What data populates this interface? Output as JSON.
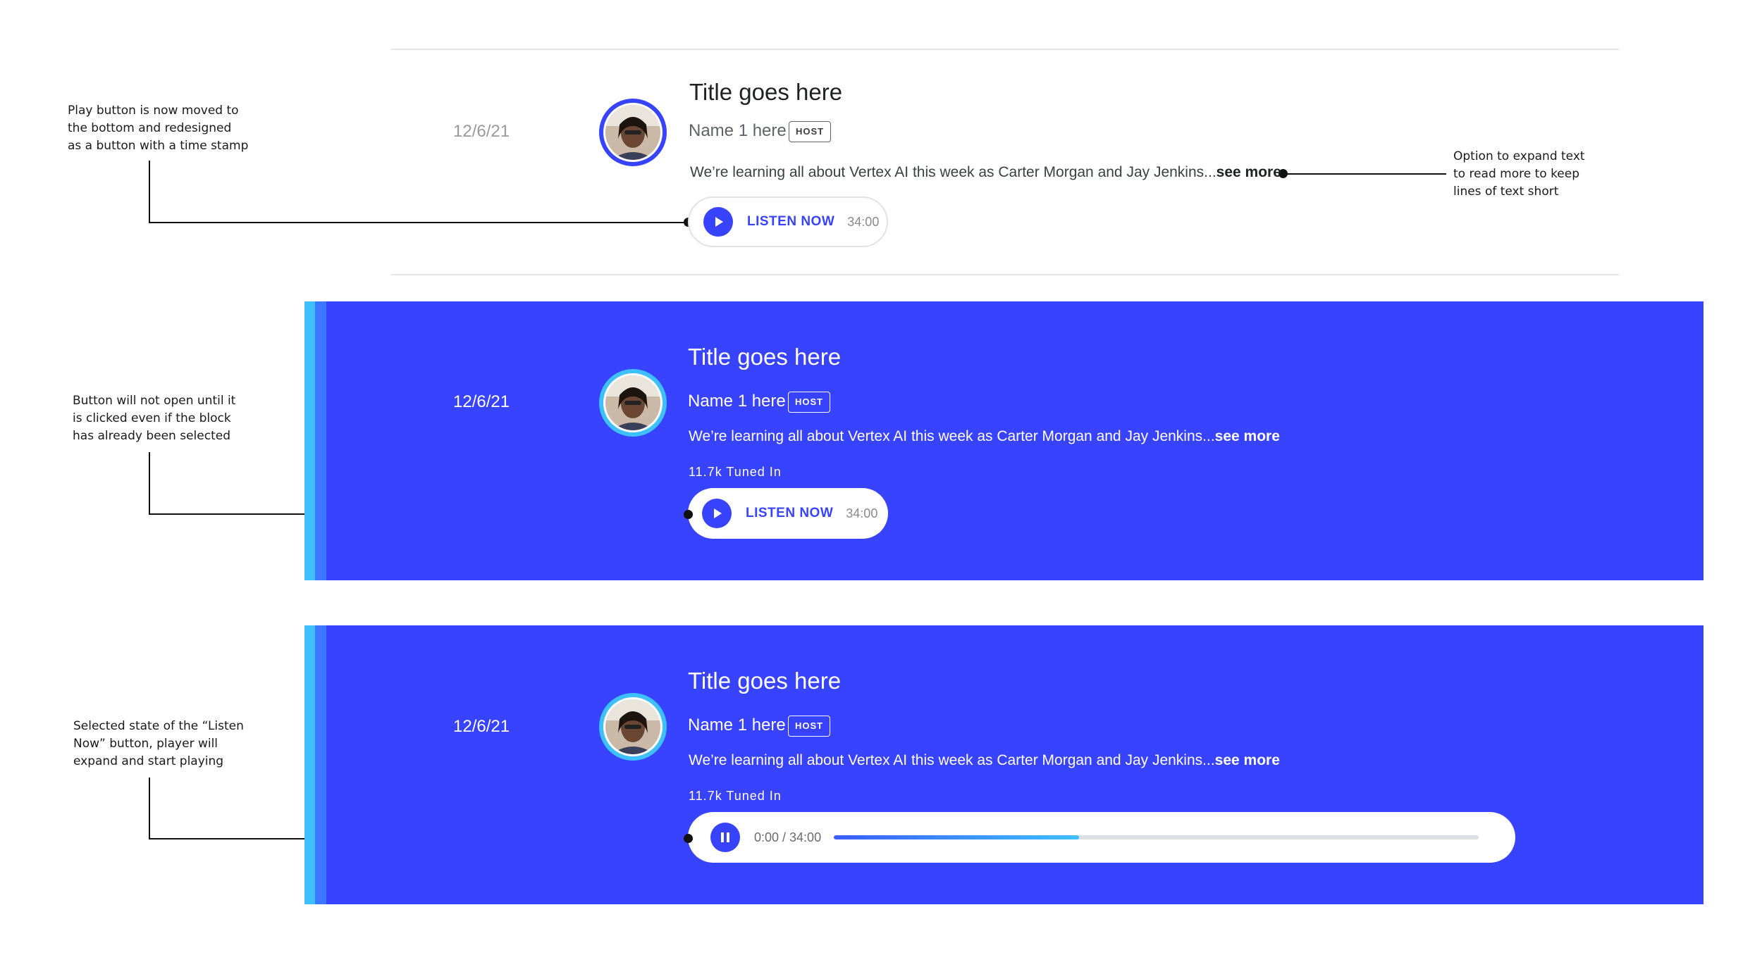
{
  "annotations": [
    {
      "text": "Play button is now moved to\nthe bottom and redesigned\nas a button with a time stamp"
    },
    {
      "text": "Option to expand text\nto read more to keep\nlines of text short"
    },
    {
      "text": "Button will not open until it\nis clicked even if the block\nhas already been selected"
    },
    {
      "text": "Selected state of the “Listen\nNow” button, player will\nexpand and start playing"
    }
  ],
  "colors": {
    "accent": "#3843ff",
    "stripe_light": "#3ec0ff",
    "stripe_mid": "#3a78ff",
    "divider": "#e6e6e6"
  },
  "cards": [
    {
      "state": "default",
      "date": "12/6/21",
      "title": "Title goes here",
      "name": "Name 1 here",
      "badge": "HOST",
      "description": "We’re learning all about Vertex AI this week as Carter Morgan and Jay Jenkins...",
      "see_more": "see more",
      "listen_label": "LISTEN NOW",
      "duration": "34:00",
      "avatar_icon": "host-avatar-photo",
      "play_icon": "play-icon"
    },
    {
      "state": "selected",
      "date": "12/6/21",
      "title": "Title goes here",
      "name": "Name 1 here",
      "badge": "HOST",
      "description": "We’re learning all about Vertex AI this week as Carter Morgan and Jay Jenkins...",
      "see_more": "see more",
      "tuned_in": "11.7k Tuned In",
      "listen_label": "LISTEN NOW",
      "duration": "34:00",
      "avatar_icon": "host-avatar-photo",
      "play_icon": "play-icon"
    },
    {
      "state": "playing",
      "date": "12/6/21",
      "title": "Title goes here",
      "name": "Name 1 here",
      "badge": "HOST",
      "description": "We’re learning all about Vertex AI this week as Carter Morgan and Jay Jenkins...",
      "see_more": "see more",
      "tuned_in": "11.7k Tuned In",
      "player_time": "0:00 / 34:00",
      "progress_fraction": 0.38,
      "avatar_icon": "host-avatar-photo",
      "pause_icon": "pause-icon"
    }
  ]
}
